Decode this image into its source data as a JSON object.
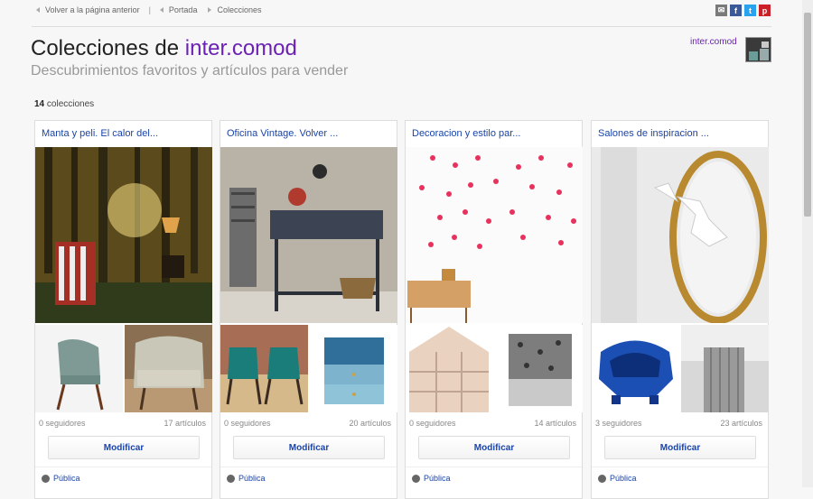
{
  "breadcrumbs": {
    "back": "Volver a la página anterior",
    "separator": "|",
    "home": "Portada",
    "current": "Colecciones"
  },
  "share": [
    {
      "icon": "mail-icon",
      "glyph": "✉",
      "color": "#7a7a7a"
    },
    {
      "icon": "facebook-icon",
      "glyph": "f",
      "color": "#3b5998"
    },
    {
      "icon": "twitter-icon",
      "glyph": "t",
      "color": "#2aa3ef"
    },
    {
      "icon": "pinterest-icon",
      "glyph": "p",
      "color": "#cb2027"
    }
  ],
  "header": {
    "title_prefix": "Colecciones de",
    "user": "inter.comod",
    "subtitle": "Descubrimientos favoritos y artículos para vender",
    "user_link": "inter.comod"
  },
  "collections_count": {
    "number": "14",
    "label": "colecciones"
  },
  "cards": [
    {
      "title": "Manta y peli. El calor del...",
      "followers": "0 seguidores",
      "articles": "17 artículos",
      "button": "Modificar",
      "visibility": "Pública"
    },
    {
      "title": "Oficina Vintage. Volver ...",
      "followers": "0 seguidores",
      "articles": "20 artículos",
      "button": "Modificar",
      "visibility": "Pública"
    },
    {
      "title": "Decoracion y estilo par...",
      "followers": "0 seguidores",
      "articles": "14 artículos",
      "button": "Modificar",
      "visibility": "Pública"
    },
    {
      "title": "Salones de inspiracion ...",
      "followers": "3 seguidores",
      "articles": "23 artículos",
      "button": "Modificar",
      "visibility": "Pública"
    }
  ],
  "colors": {
    "accent": "#6b22b3",
    "link": "#1a44a8"
  }
}
